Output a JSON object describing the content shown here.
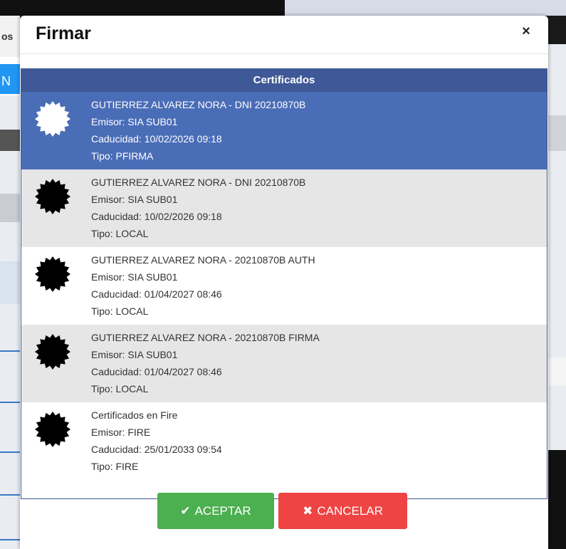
{
  "background": {
    "left_fragment": "os",
    "left_blue_fragment": "N"
  },
  "modal": {
    "title": "Firmar",
    "close_label": "×"
  },
  "panel": {
    "header": "Certificados",
    "certificates": [
      {
        "name": "GUTIERREZ ALVAREZ NORA - DNI 20210870B",
        "issuer": "Emisor: SIA SUB01",
        "expiry": "Caducidad: 10/02/2026 09:18",
        "type": "Tipo: PFIRMA",
        "selected": true
      },
      {
        "name": "GUTIERREZ ALVAREZ NORA - DNI 20210870B",
        "issuer": "Emisor: SIA SUB01",
        "expiry": "Caducidad: 10/02/2026 09:18",
        "type": "Tipo: LOCAL",
        "selected": false
      },
      {
        "name": "GUTIERREZ ALVAREZ NORA - 20210870B AUTH",
        "issuer": "Emisor: SIA SUB01",
        "expiry": "Caducidad: 01/04/2027 08:46",
        "type": "Tipo: LOCAL",
        "selected": false
      },
      {
        "name": "GUTIERREZ ALVAREZ NORA - 20210870B FIRMA",
        "issuer": "Emisor: SIA SUB01",
        "expiry": "Caducidad: 01/04/2027 08:46",
        "type": "Tipo: LOCAL",
        "selected": false
      },
      {
        "name": "Certificados en Fire",
        "issuer": "Emisor: FIRE",
        "expiry": "Caducidad: 25/01/2033 09:54",
        "type": "Tipo: FIRE",
        "selected": false
      }
    ]
  },
  "buttons": {
    "accept": {
      "icon": "check-icon",
      "label": "ACEPTAR",
      "color": "#4caf50"
    },
    "cancel": {
      "icon": "times-icon",
      "label": "CANCELAR",
      "color": "#ef4444"
    }
  },
  "colors": {
    "panel_header": "#3f5897",
    "selected_row": "#4a6db7",
    "alt_row": "#e6e6e6"
  }
}
